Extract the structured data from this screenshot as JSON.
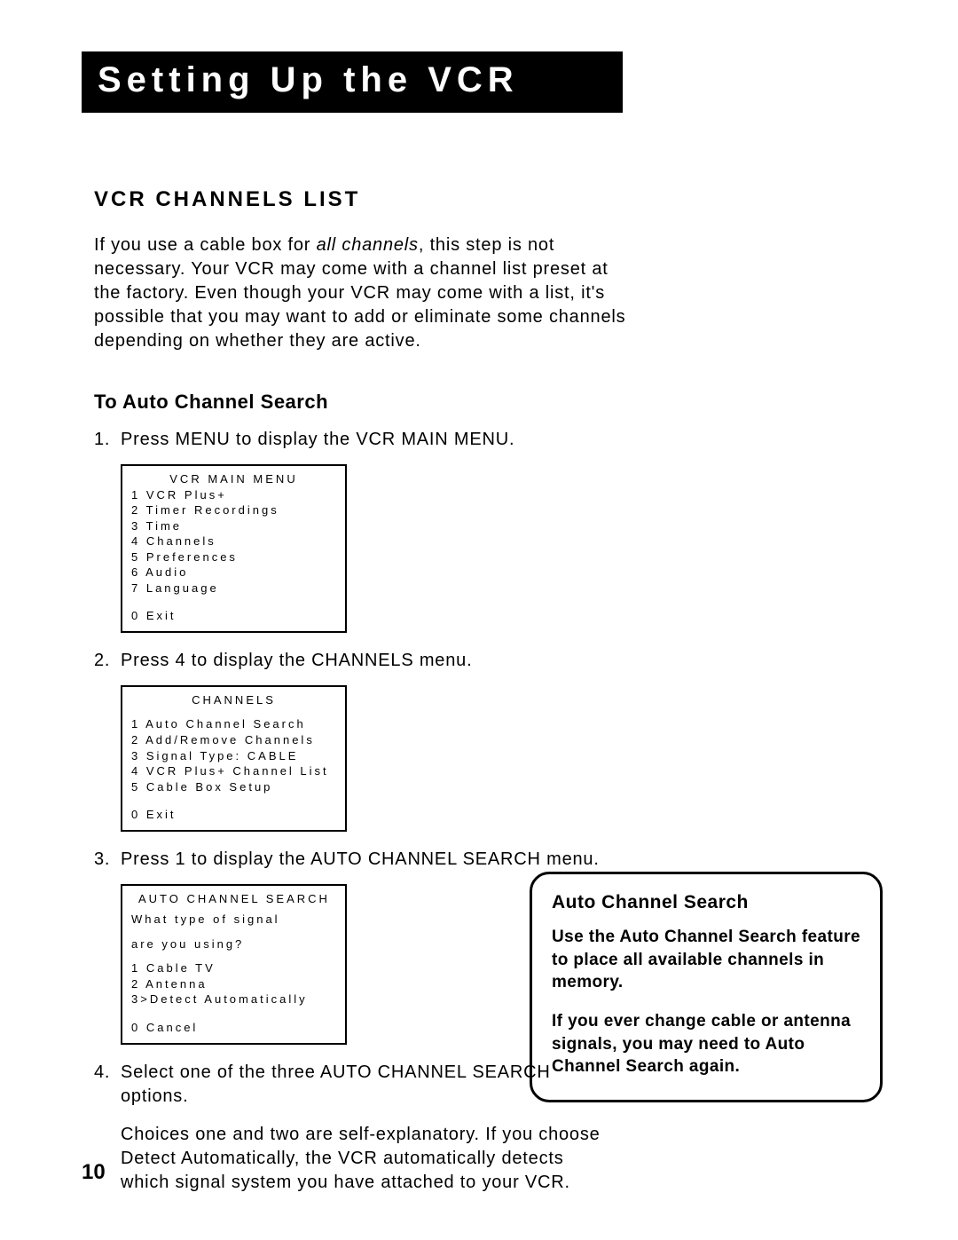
{
  "title": "Setting Up the VCR",
  "section_heading": "VCR CHANNELS LIST",
  "intro_pre": "If you use a cable box for ",
  "intro_italic": "all channels",
  "intro_post": ", this step is not necessary. Your VCR may come with a channel list preset at the factory. Even though your VCR may come with a list, it's possible that you may want to add or eliminate some channels depending on whether they are active.",
  "sub_heading": "To Auto Channel Search",
  "steps": {
    "s1": {
      "num": "1.",
      "text": "Press MENU to display the VCR MAIN MENU."
    },
    "s2": {
      "num": "2.",
      "text": "Press 4 to display the CHANNELS menu."
    },
    "s3": {
      "num": "3.",
      "text": "Press 1 to display the AUTO CHANNEL SEARCH menu."
    },
    "s4": {
      "num": "4.",
      "text": "Select one of the three AUTO CHANNEL SEARCH options.",
      "text2": "Choices one and two are self-explanatory. If you choose Detect Automatically, the VCR automatically detects which signal system you have attached to your VCR."
    }
  },
  "menu1": {
    "title": "VCR MAIN MENU",
    "items": [
      "1 VCR Plus+",
      "2 Timer Recordings",
      "3 Time",
      "4 Channels",
      "5 Preferences",
      "6 Audio",
      "7 Language"
    ],
    "exit": "0 Exit"
  },
  "menu2": {
    "title": "CHANNELS",
    "items": [
      "1 Auto Channel Search",
      "2 Add/Remove Channels",
      "3 Signal Type: CABLE",
      "4 VCR Plus+ Channel List",
      "5 Cable Box Setup"
    ],
    "exit": "0 Exit"
  },
  "menu3": {
    "title": "AUTO CHANNEL SEARCH",
    "q1": "What type of signal",
    "q2": "are you using?",
    "items": [
      "1 Cable TV",
      "2 Antenna",
      "3>Detect Automatically"
    ],
    "exit": "0 Cancel"
  },
  "sidebox": {
    "title": "Auto Channel Search",
    "p1": "Use the Auto Channel Search feature to place all available channels in memory.",
    "p2": "If you ever change cable or antenna signals, you may need to Auto Channel Search again."
  },
  "page_number": "10"
}
